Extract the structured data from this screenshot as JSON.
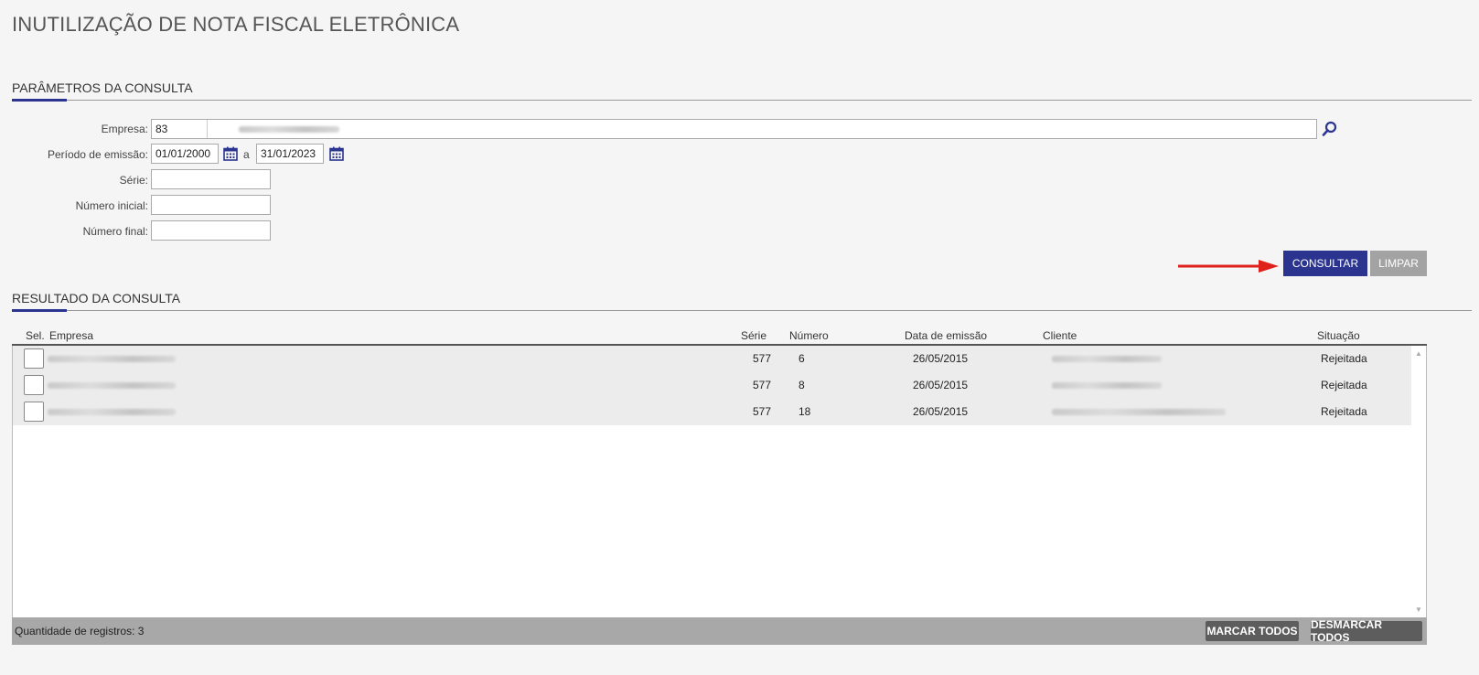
{
  "page": {
    "title": "INUTILIZAÇÃO DE NOTA FISCAL ELETRÔNICA"
  },
  "params": {
    "section_title": "PARÂMETROS DA CONSULTA",
    "empresa_label": "Empresa:",
    "empresa_code": "83",
    "periodo_label": "Período de emissão:",
    "date_from": "01/01/2000",
    "date_sep": "a",
    "date_to": "31/01/2023",
    "serie_label": "Série:",
    "serie_value": "",
    "numero_inicial_label": "Número inicial:",
    "numero_inicial_value": "",
    "numero_final_label": "Número final:",
    "numero_final_value": ""
  },
  "actions": {
    "consultar": "CONSULTAR",
    "limpar": "LIMPAR"
  },
  "results": {
    "section_title": "RESULTADO DA CONSULTA",
    "columns": [
      "Sel.",
      "Empresa",
      "Série",
      "Número",
      "Data de emissão",
      "Cliente",
      "Situação"
    ],
    "rows": [
      {
        "serie": "577",
        "numero": "6",
        "data": "26/05/2015",
        "situacao": "Rejeitada"
      },
      {
        "serie": "577",
        "numero": "8",
        "data": "26/05/2015",
        "situacao": "Rejeitada"
      },
      {
        "serie": "577",
        "numero": "18",
        "data": "26/05/2015",
        "situacao": "Rejeitada"
      }
    ]
  },
  "footer": {
    "count_label": "Quantidade de registros:",
    "count_value": "3",
    "marcar_todos": "MARCAR TODOS",
    "desmarcar_todos": "DESMARCAR TODOS"
  },
  "colors": {
    "primary": "#2b3590",
    "disabled": "#a3a3a3",
    "arrow": "#e0201b"
  }
}
